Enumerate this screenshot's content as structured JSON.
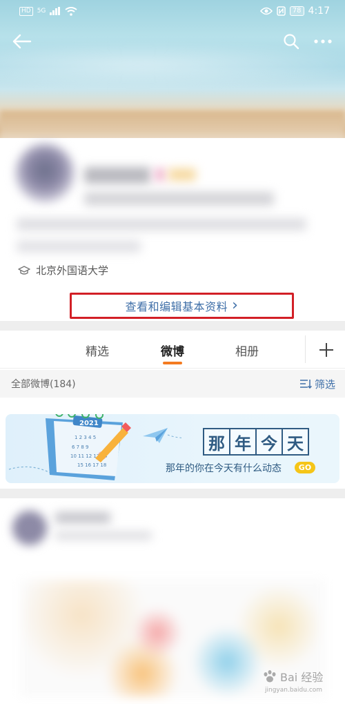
{
  "status_bar": {
    "hd": "HD",
    "network": "5G",
    "battery": "78",
    "time": "4:17"
  },
  "nav": {
    "back_icon": "arrow-left-icon",
    "search_icon": "search-icon",
    "more_icon": "more-icon"
  },
  "profile": {
    "school": "北京外国语大学",
    "edit_link": "查看和编辑基本资料",
    "edit_chevron": "›"
  },
  "tabs": {
    "items": [
      {
        "label": "精选"
      },
      {
        "label": "微博"
      },
      {
        "label": "相册"
      }
    ],
    "active_index": 1,
    "add_label": "+"
  },
  "list_header": {
    "title": "全部微博(184)",
    "filter_label": "筛选"
  },
  "promo": {
    "calendar_year": "2021",
    "calendar_numbers": "1 2 3 4 5 6 7 8 9 10 11 12 13 14 15 16 17 18 19 20",
    "title_chars": [
      "那",
      "年",
      "今",
      "天"
    ],
    "subtitle": "那年的你在今天有什么动态",
    "go_label": "GO"
  },
  "watermark": {
    "brand": "Bai 经验",
    "url": "jingyan.baidu.com"
  },
  "colors": {
    "accent_orange": "#f47b20",
    "link_blue": "#3f6fa8",
    "highlight_red": "#d21f26",
    "promo_navy": "#2f5b82",
    "go_yellow": "#f5c518"
  }
}
